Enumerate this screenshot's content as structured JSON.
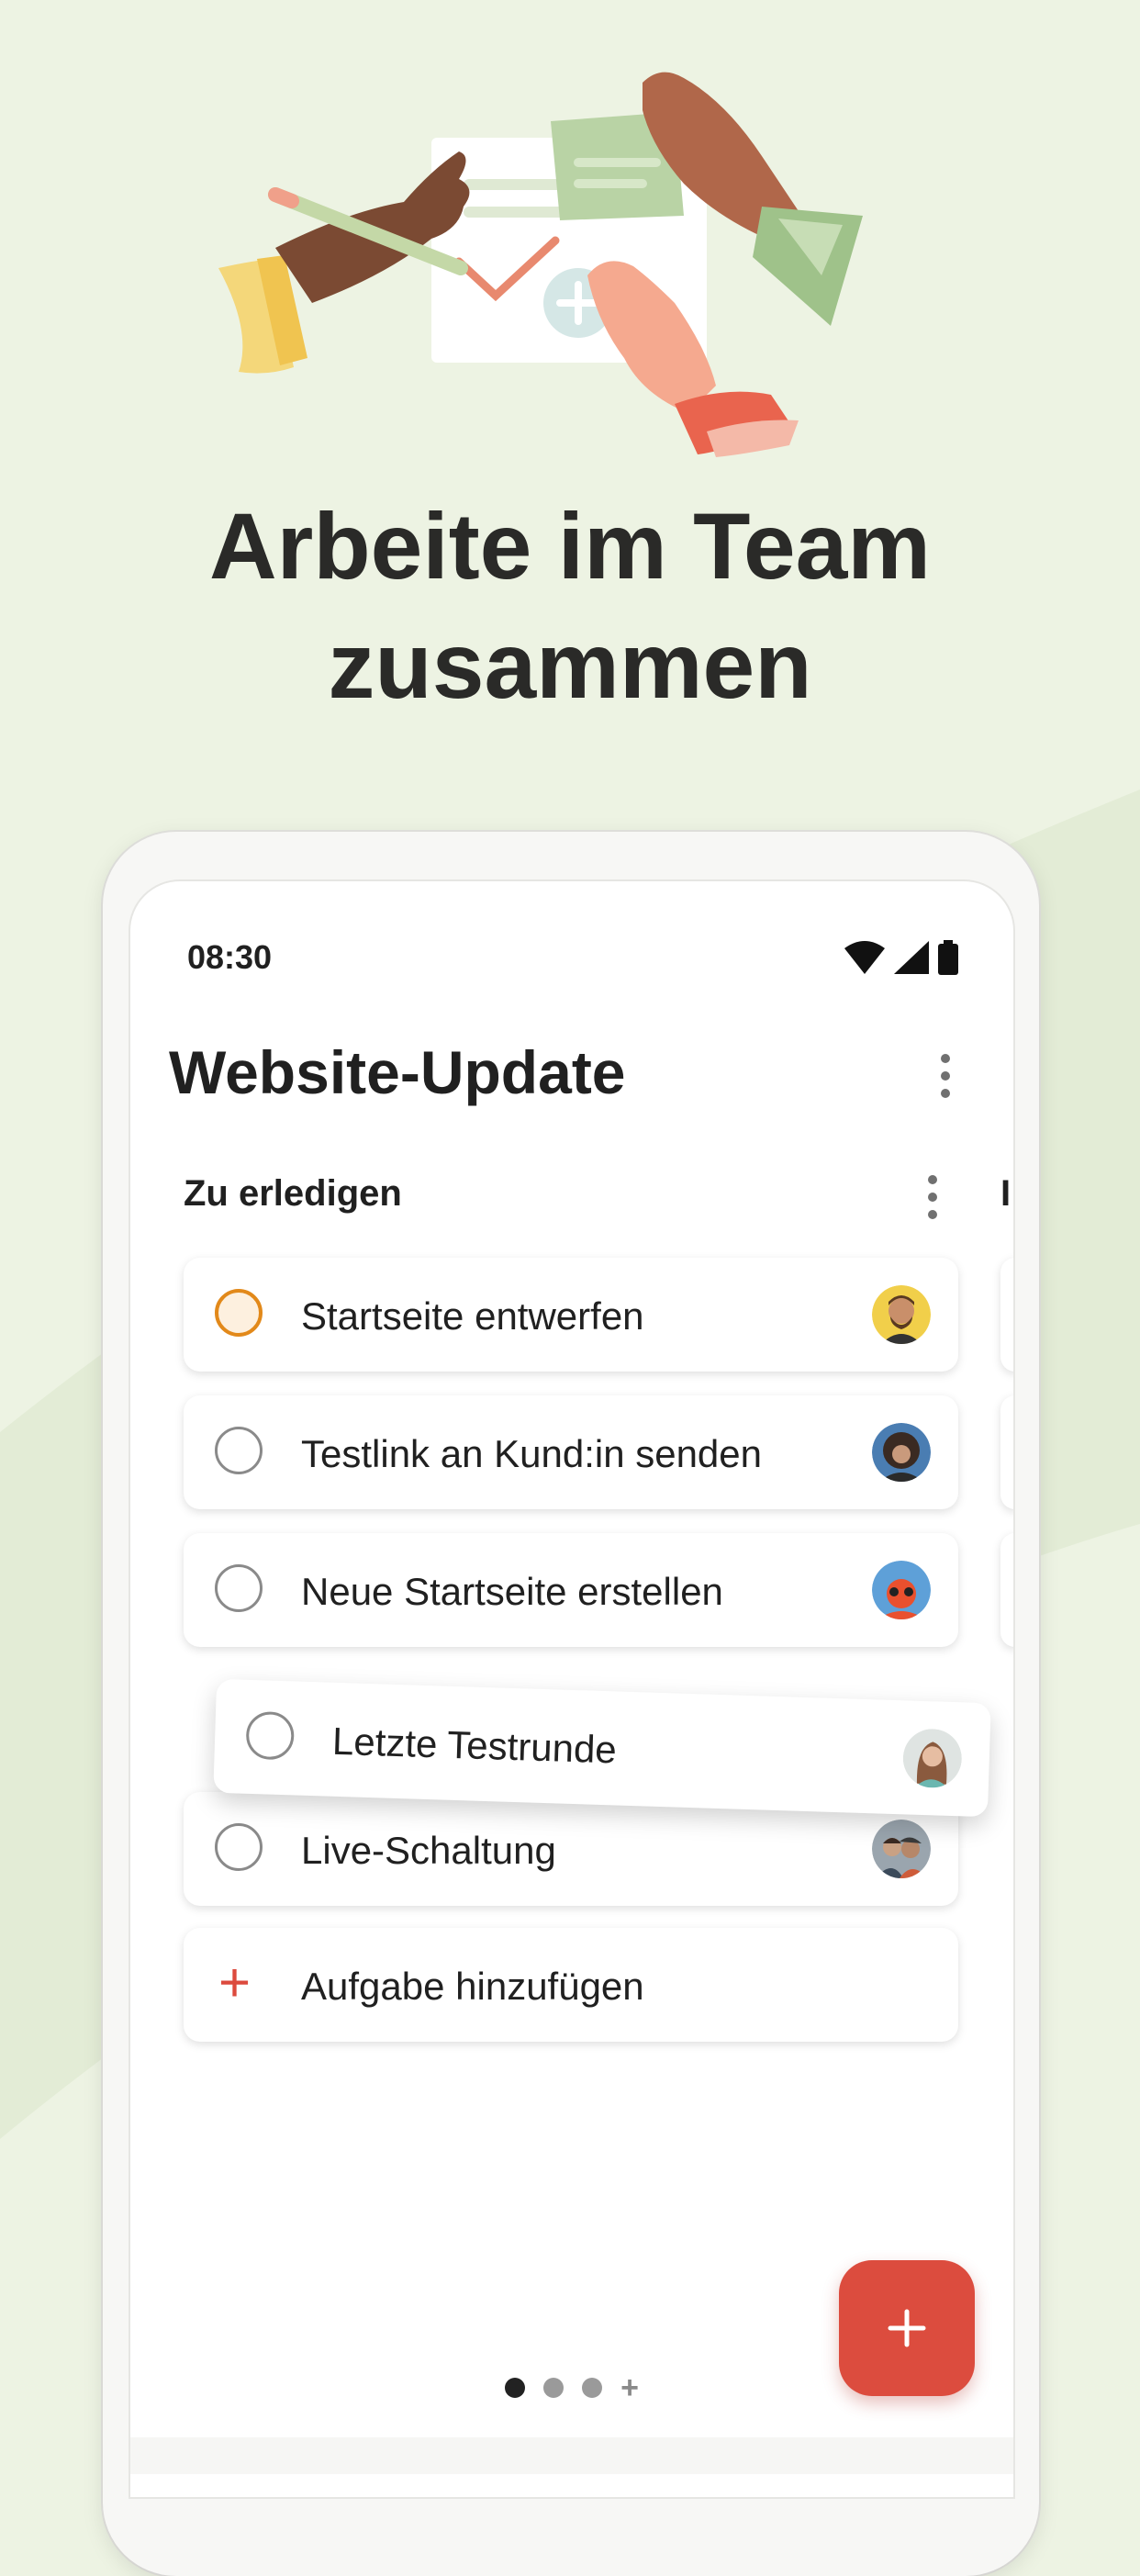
{
  "headline": {
    "line1": "Arbeite im Team",
    "line2": "zusammen"
  },
  "status_bar": {
    "time": "08:30",
    "icons": [
      "wifi-icon",
      "signal-icon",
      "battery-icon"
    ]
  },
  "project": {
    "title": "Website-Update"
  },
  "section": {
    "title": "Zu erledigen",
    "next_column_initial": "I"
  },
  "tasks": [
    {
      "label": "Startseite entwerfen",
      "priority": true,
      "avatar": "avatar-man-beard"
    },
    {
      "label": "Testlink an Kund:in senden",
      "priority": false,
      "avatar": "avatar-person-curly-hair"
    },
    {
      "label": "Neue Startseite erstellen",
      "priority": false,
      "avatar": "avatar-person-red"
    },
    {
      "label": "Letzte Testrunde",
      "priority": false,
      "dragging": true,
      "avatar": "avatar-woman-long-hair"
    },
    {
      "label": "Live-Schaltung",
      "priority": false,
      "avatar": "avatar-two-people"
    }
  ],
  "add_task": {
    "label": "Aufgabe hinzufügen",
    "icon": "plus-icon"
  },
  "fab": {
    "icon": "plus-icon"
  },
  "pager": {
    "page_count": 3,
    "active_index": 0,
    "add_icon": "plus-icon"
  },
  "colors": {
    "accent_red": "#dc4c3e",
    "priority_orange": "#e2891a",
    "background_green": "#edf3e3"
  }
}
